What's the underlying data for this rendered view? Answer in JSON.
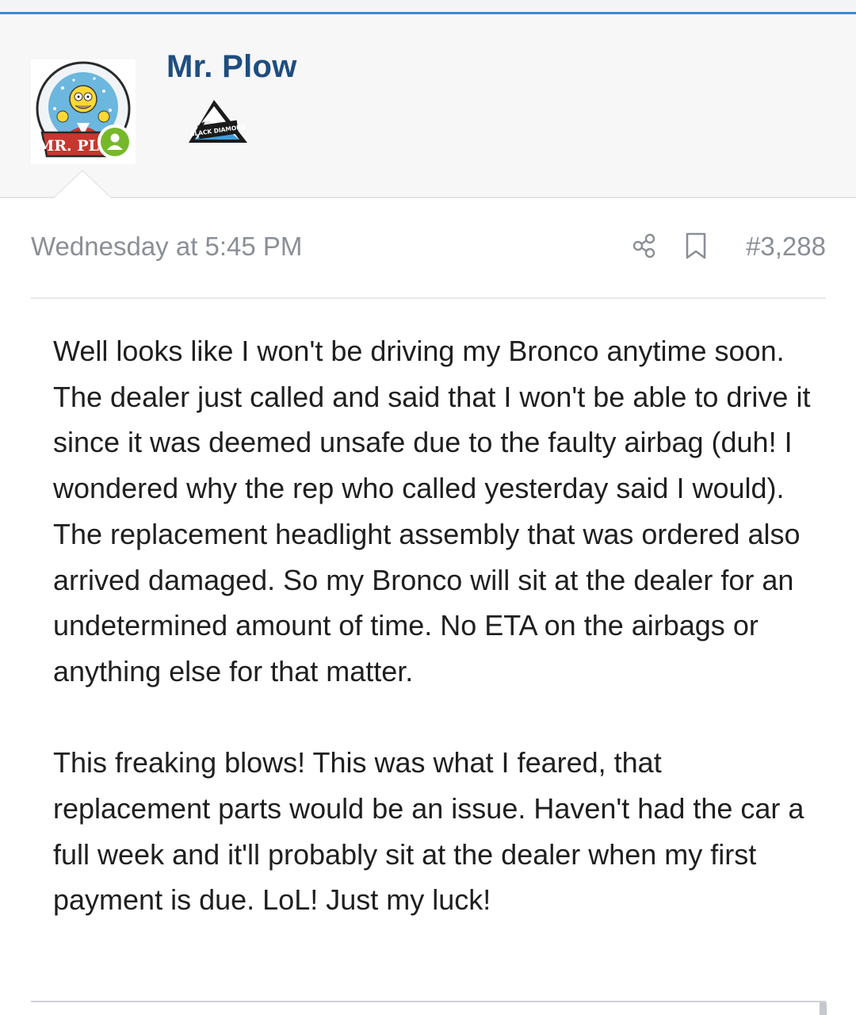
{
  "post": {
    "author": {
      "name": "Mr. Plow",
      "avatar_text": "MR. PLOW",
      "rank_badge_text": "BLACK DIAMOND",
      "online": true
    },
    "date": "Wednesday at 5:45 PM",
    "number": "#3,288",
    "body": [
      "Well looks like I won't be driving my Bronco anytime soon. The dealer just called and said that I won't be able to drive it since it was deemed unsafe due to the faulty airbag (duh! I wondered why the rep who called yesterday said I would). The replacement headlight assembly that was ordered also arrived damaged. So my Bronco will sit at the dealer for an undetermined amount of time. No ETA on the airbags or anything else for that matter.",
      "This freaking blows! This was what I feared, that replacement parts would be an issue. Haven't had the car a full week and it'll probably sit at the dealer when my first payment is due. LoL! Just my luck!"
    ]
  },
  "icons": {
    "share": "share-icon",
    "bookmark": "bookmark-icon",
    "online": "user-online-icon"
  },
  "colors": {
    "accent": "#3d87d6",
    "username": "#1f4d80",
    "online": "#76b82a",
    "meta_text": "#8a8f97",
    "body_text": "#1f1f1f"
  }
}
